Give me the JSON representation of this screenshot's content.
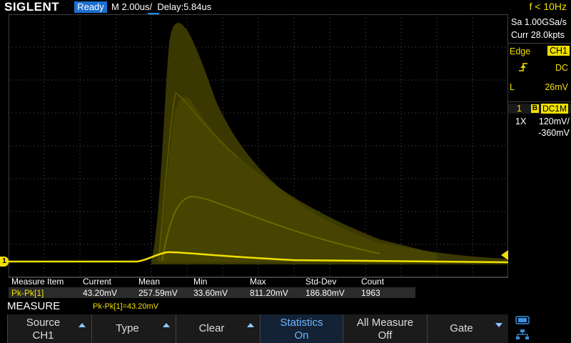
{
  "topbar": {
    "brand": "SIGLENT",
    "status": "Ready",
    "timebase": "M 2.00us/",
    "delay": "Delay:5.84us",
    "trigger_freq": "f < 10Hz"
  },
  "acquisition": {
    "sample_rate": "Sa 1.00GSa/s",
    "memory": "Curr 28.0kpts"
  },
  "trigger": {
    "type": "Edge",
    "source": "CH1",
    "coupling": "DC",
    "level_label": "L",
    "level": "26mV"
  },
  "channel1": {
    "number": "1",
    "bw_badge": "B",
    "coupling": "DC1M",
    "probe": "1X",
    "scale": "120mV/",
    "offset": "-360mV",
    "marker": "1"
  },
  "measure_table": {
    "headers": [
      "Measure Item",
      "Current",
      "Mean",
      "Min",
      "Max",
      "Std-Dev",
      "Count"
    ],
    "row": [
      "Pk-Pk[1]",
      "43.20mV",
      "257.59mV",
      "33.60mV",
      "811.20mV",
      "186.80mV",
      "1963"
    ]
  },
  "menu": {
    "title": "MEASURE",
    "readout": "Pk-Pk[1]=43.20mV",
    "softkeys": [
      {
        "line1": "Source",
        "line2": "CH1"
      },
      {
        "line1": "Type",
        "line2": ""
      },
      {
        "line1": "Clear",
        "line2": ""
      },
      {
        "line1": "Statistics",
        "line2": "On"
      },
      {
        "line1": "All Measure",
        "line2": "Off"
      },
      {
        "line1": "Gate",
        "line2": ""
      }
    ]
  },
  "colors": {
    "trace": "#f0e000",
    "trace_persist": "#5a5600",
    "grid": "#5a5a5a",
    "accent": "#1c6fd0",
    "active_key": "#6fb6ff"
  },
  "icons": [
    "trigger-rising-edge-icon",
    "usb-icon",
    "network-icon",
    "trigger-position-marker-icon",
    "trigger-level-marker-icon"
  ]
}
